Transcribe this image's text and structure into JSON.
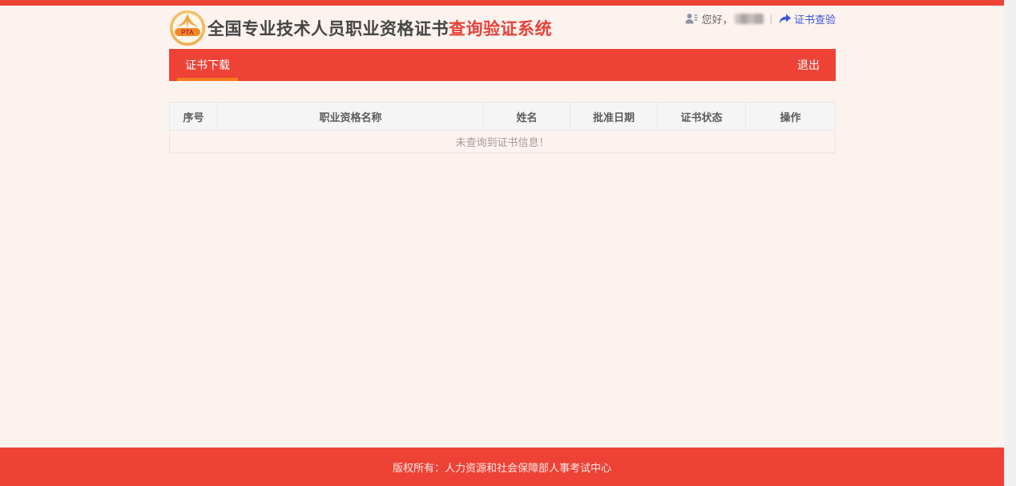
{
  "brand": {
    "logo_text": "PTA",
    "title_black": "全国专业技术人员职业资格证书",
    "title_red": "查询验证系统"
  },
  "user_bar": {
    "greeting": "您好，",
    "separator": "|",
    "verify_link": "证书查验"
  },
  "nav": {
    "active_tab": "证书下载",
    "logout": "退出"
  },
  "table": {
    "columns": [
      "序号",
      "职业资格名称",
      "姓名",
      "批准日期",
      "证书状态",
      "操作"
    ],
    "empty_message": "未查询到证书信息！"
  },
  "footer": {
    "copyright": "版权所有：人力资源和社会保障部人事考试中心"
  },
  "colors": {
    "primary_red": "#ee4237",
    "accent_orange": "#f57c1f",
    "link_blue": "#3a56d4",
    "page_background": "#fdf3ee",
    "table_header_bg": "#f5f5f5"
  }
}
